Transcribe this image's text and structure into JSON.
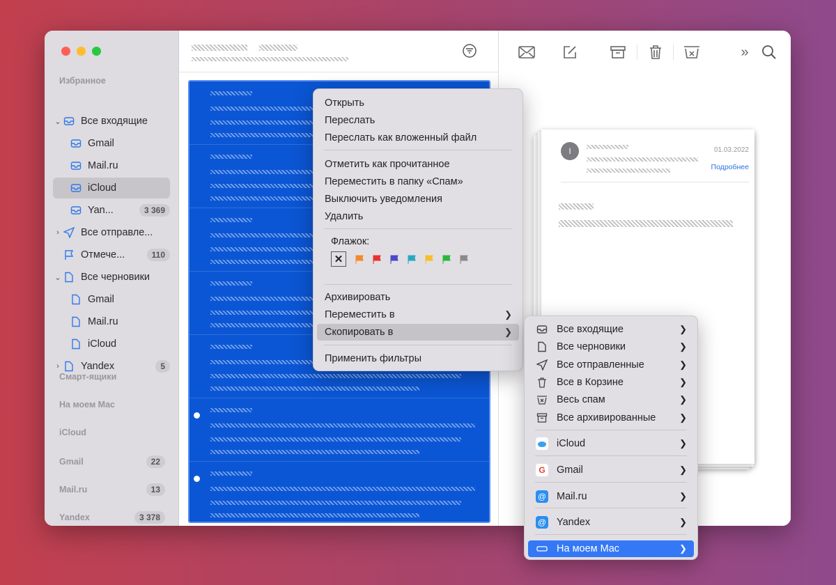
{
  "sidebar": {
    "favorites": "Избранное",
    "items": [
      {
        "label": "Все входящие"
      },
      {
        "label": "Gmail"
      },
      {
        "label": "Mail.ru"
      },
      {
        "label": "iCloud"
      },
      {
        "label": "Yan...",
        "badge": "3 369"
      },
      {
        "label": "Все отправле..."
      },
      {
        "label": "Отмече...",
        "badge": "110"
      },
      {
        "label": "Все черновики"
      },
      {
        "label": "Gmail"
      },
      {
        "label": "Mail.ru"
      },
      {
        "label": "iCloud"
      },
      {
        "label": "Yandex",
        "badge": "5"
      }
    ],
    "sections": [
      {
        "label": "Смарт-ящики"
      },
      {
        "label": "На моем Mac"
      },
      {
        "label": "iCloud"
      },
      {
        "label": "Gmail",
        "badge": "22"
      },
      {
        "label": "Mail.ru",
        "badge": "13"
      },
      {
        "label": "Yandex",
        "badge": "3 378"
      }
    ]
  },
  "reader": {
    "date": "01.03.2022",
    "details_link": "Подробнее",
    "avatar_letter": "I"
  },
  "context_menu": {
    "items": [
      "Открыть",
      "Переслать",
      "Переслать как вложенный файл",
      "Отметить как прочитанное",
      "Переместить в папку «Спам»",
      "Выключить уведомления",
      "Удалить"
    ],
    "flag_label": "Флажок:",
    "flag_colors": [
      "#f28a2a",
      "#ea3030",
      "#4a4ac8",
      "#2aa8c0",
      "#f5c02a",
      "#2ab83a",
      "#8a8a8a"
    ],
    "archive": "Архивировать",
    "move_to": "Переместить в",
    "copy_to": "Скопировать в",
    "apply_filters": "Применить фильтры"
  },
  "submenu": {
    "items": [
      "Все входящие",
      "Все черновики",
      "Все отправленные",
      "Все в Корзине",
      "Весь спам",
      "Все архивированные"
    ],
    "accounts": [
      "iCloud",
      "Gmail",
      "Mail.ru",
      "Yandex",
      "На моем Mac"
    ]
  },
  "colors": {
    "accent": "#3478f6",
    "selection": "#0b56d4"
  }
}
